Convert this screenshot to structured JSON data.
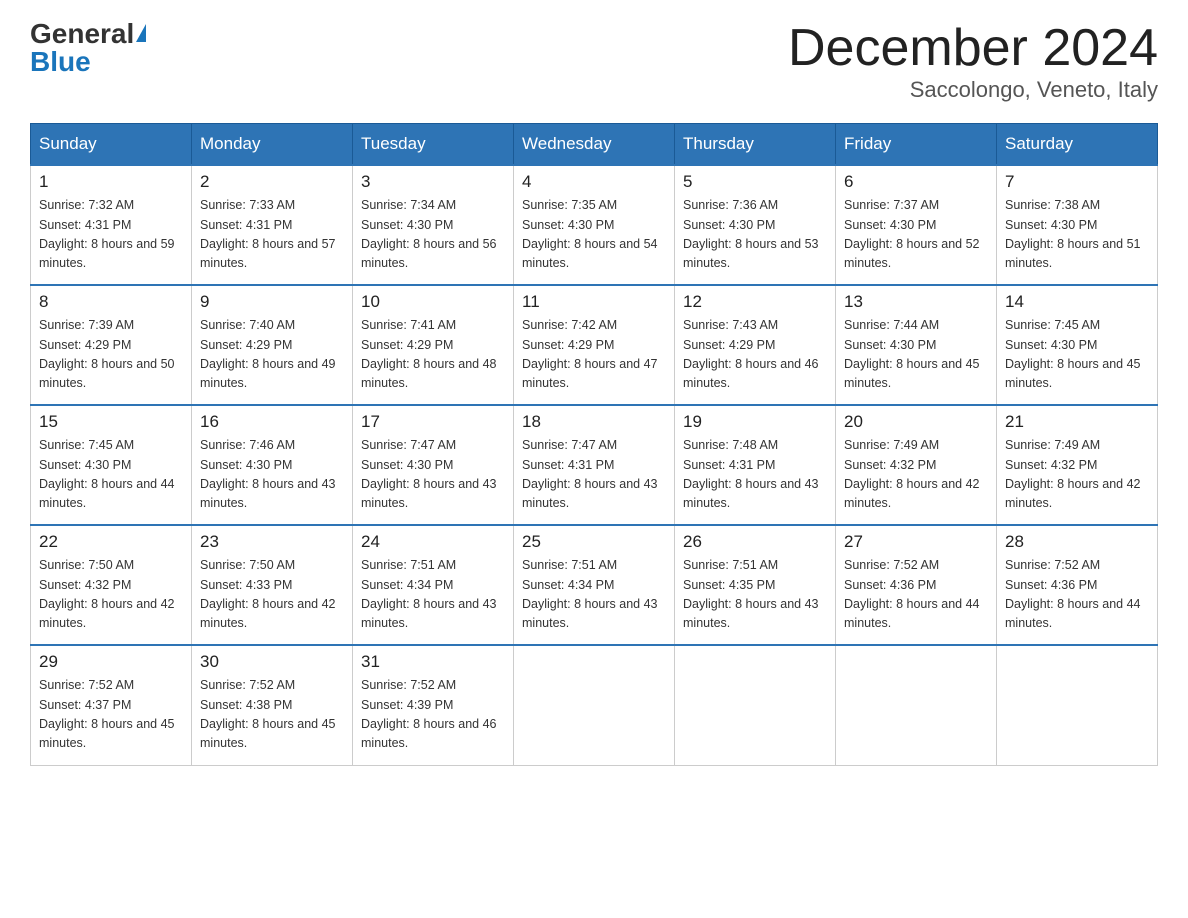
{
  "header": {
    "logo_general": "General",
    "logo_blue": "Blue",
    "month_title": "December 2024",
    "location": "Saccolongo, Veneto, Italy"
  },
  "days_of_week": [
    "Sunday",
    "Monday",
    "Tuesday",
    "Wednesday",
    "Thursday",
    "Friday",
    "Saturday"
  ],
  "weeks": [
    [
      {
        "day": "1",
        "sunrise": "7:32 AM",
        "sunset": "4:31 PM",
        "daylight": "8 hours and 59 minutes."
      },
      {
        "day": "2",
        "sunrise": "7:33 AM",
        "sunset": "4:31 PM",
        "daylight": "8 hours and 57 minutes."
      },
      {
        "day": "3",
        "sunrise": "7:34 AM",
        "sunset": "4:30 PM",
        "daylight": "8 hours and 56 minutes."
      },
      {
        "day": "4",
        "sunrise": "7:35 AM",
        "sunset": "4:30 PM",
        "daylight": "8 hours and 54 minutes."
      },
      {
        "day": "5",
        "sunrise": "7:36 AM",
        "sunset": "4:30 PM",
        "daylight": "8 hours and 53 minutes."
      },
      {
        "day": "6",
        "sunrise": "7:37 AM",
        "sunset": "4:30 PM",
        "daylight": "8 hours and 52 minutes."
      },
      {
        "day": "7",
        "sunrise": "7:38 AM",
        "sunset": "4:30 PM",
        "daylight": "8 hours and 51 minutes."
      }
    ],
    [
      {
        "day": "8",
        "sunrise": "7:39 AM",
        "sunset": "4:29 PM",
        "daylight": "8 hours and 50 minutes."
      },
      {
        "day": "9",
        "sunrise": "7:40 AM",
        "sunset": "4:29 PM",
        "daylight": "8 hours and 49 minutes."
      },
      {
        "day": "10",
        "sunrise": "7:41 AM",
        "sunset": "4:29 PM",
        "daylight": "8 hours and 48 minutes."
      },
      {
        "day": "11",
        "sunrise": "7:42 AM",
        "sunset": "4:29 PM",
        "daylight": "8 hours and 47 minutes."
      },
      {
        "day": "12",
        "sunrise": "7:43 AM",
        "sunset": "4:29 PM",
        "daylight": "8 hours and 46 minutes."
      },
      {
        "day": "13",
        "sunrise": "7:44 AM",
        "sunset": "4:30 PM",
        "daylight": "8 hours and 45 minutes."
      },
      {
        "day": "14",
        "sunrise": "7:45 AM",
        "sunset": "4:30 PM",
        "daylight": "8 hours and 45 minutes."
      }
    ],
    [
      {
        "day": "15",
        "sunrise": "7:45 AM",
        "sunset": "4:30 PM",
        "daylight": "8 hours and 44 minutes."
      },
      {
        "day": "16",
        "sunrise": "7:46 AM",
        "sunset": "4:30 PM",
        "daylight": "8 hours and 43 minutes."
      },
      {
        "day": "17",
        "sunrise": "7:47 AM",
        "sunset": "4:30 PM",
        "daylight": "8 hours and 43 minutes."
      },
      {
        "day": "18",
        "sunrise": "7:47 AM",
        "sunset": "4:31 PM",
        "daylight": "8 hours and 43 minutes."
      },
      {
        "day": "19",
        "sunrise": "7:48 AM",
        "sunset": "4:31 PM",
        "daylight": "8 hours and 43 minutes."
      },
      {
        "day": "20",
        "sunrise": "7:49 AM",
        "sunset": "4:32 PM",
        "daylight": "8 hours and 42 minutes."
      },
      {
        "day": "21",
        "sunrise": "7:49 AM",
        "sunset": "4:32 PM",
        "daylight": "8 hours and 42 minutes."
      }
    ],
    [
      {
        "day": "22",
        "sunrise": "7:50 AM",
        "sunset": "4:32 PM",
        "daylight": "8 hours and 42 minutes."
      },
      {
        "day": "23",
        "sunrise": "7:50 AM",
        "sunset": "4:33 PM",
        "daylight": "8 hours and 42 minutes."
      },
      {
        "day": "24",
        "sunrise": "7:51 AM",
        "sunset": "4:34 PM",
        "daylight": "8 hours and 43 minutes."
      },
      {
        "day": "25",
        "sunrise": "7:51 AM",
        "sunset": "4:34 PM",
        "daylight": "8 hours and 43 minutes."
      },
      {
        "day": "26",
        "sunrise": "7:51 AM",
        "sunset": "4:35 PM",
        "daylight": "8 hours and 43 minutes."
      },
      {
        "day": "27",
        "sunrise": "7:52 AM",
        "sunset": "4:36 PM",
        "daylight": "8 hours and 44 minutes."
      },
      {
        "day": "28",
        "sunrise": "7:52 AM",
        "sunset": "4:36 PM",
        "daylight": "8 hours and 44 minutes."
      }
    ],
    [
      {
        "day": "29",
        "sunrise": "7:52 AM",
        "sunset": "4:37 PM",
        "daylight": "8 hours and 45 minutes."
      },
      {
        "day": "30",
        "sunrise": "7:52 AM",
        "sunset": "4:38 PM",
        "daylight": "8 hours and 45 minutes."
      },
      {
        "day": "31",
        "sunrise": "7:52 AM",
        "sunset": "4:39 PM",
        "daylight": "8 hours and 46 minutes."
      },
      null,
      null,
      null,
      null
    ]
  ]
}
